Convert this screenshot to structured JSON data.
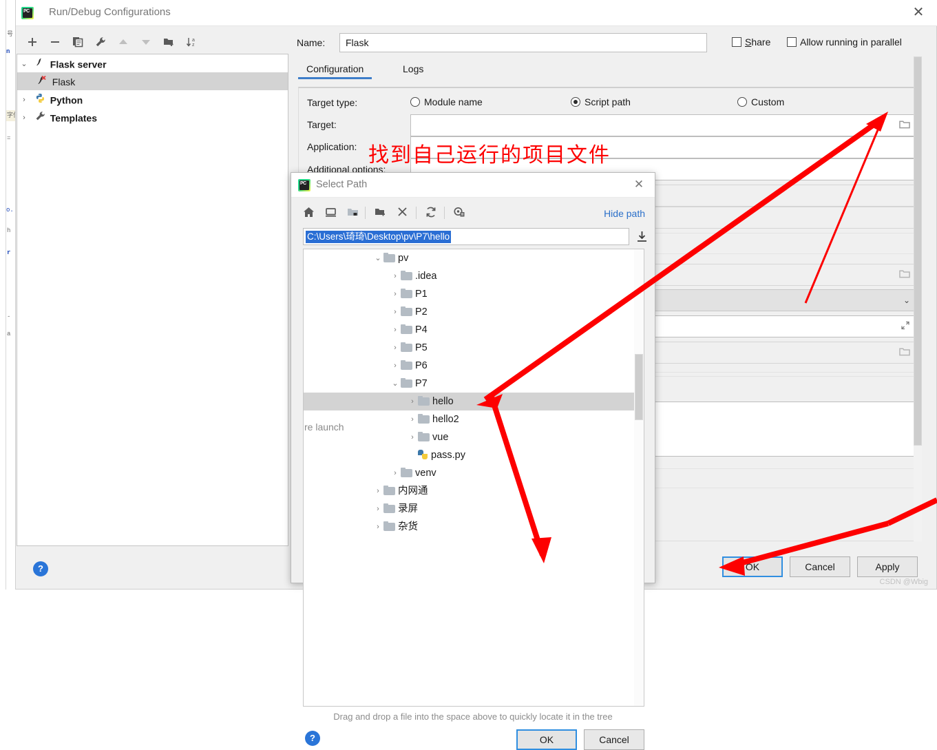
{
  "window": {
    "title": "Run/Debug Configurations",
    "close_label": "✕",
    "logo_text": "PC"
  },
  "left_toolbar": {
    "items": [
      {
        "name": "add-button",
        "icon": "plus-icon",
        "enabled": true
      },
      {
        "name": "remove-button",
        "icon": "minus-icon",
        "enabled": true
      },
      {
        "name": "copy-button",
        "icon": "copy-icon",
        "enabled": true
      },
      {
        "name": "edit-templates-button",
        "icon": "wrench-icon",
        "enabled": true
      },
      {
        "name": "move-up-button",
        "icon": "arrow-up-icon",
        "enabled": false
      },
      {
        "name": "move-down-button",
        "icon": "arrow-down-icon",
        "enabled": false
      },
      {
        "name": "new-folder-button",
        "icon": "folder-add-icon",
        "enabled": true
      },
      {
        "name": "sort-button",
        "icon": "sort-az-icon",
        "enabled": true
      }
    ]
  },
  "config_tree": {
    "items": [
      {
        "label": "Flask server",
        "expander": "⌄",
        "icon": "flask-icon",
        "indent": 0,
        "bold": true,
        "selected": false
      },
      {
        "label": "Flask",
        "expander": "",
        "icon": "flask-error-icon",
        "indent": 1,
        "bold": false,
        "selected": true
      },
      {
        "label": "Python",
        "expander": "›",
        "icon": "python-icon",
        "indent": 0,
        "bold": true,
        "selected": false
      },
      {
        "label": "Templates",
        "expander": "›",
        "icon": "wrench-icon",
        "indent": 0,
        "bold": true,
        "selected": false
      }
    ]
  },
  "help_button_label": "?",
  "form": {
    "name_label": "Name:",
    "name_value": "Flask",
    "share_label_pre": "",
    "share_label": "Share",
    "share_underline": "S",
    "parallel_label": "Allow running in parallel",
    "parallel_underline": "p",
    "tabs": [
      {
        "label": "Configuration",
        "active": true
      },
      {
        "label": "Logs",
        "active": false
      }
    ],
    "target_type_label": "Target type:",
    "target_type_options": [
      {
        "label": "Module name",
        "selected": false
      },
      {
        "label": "Script path",
        "selected": true
      },
      {
        "label": "Custom",
        "selected": false
      }
    ],
    "target_label": "Target:",
    "target_value": "",
    "application_label": "Application:",
    "application_value": "",
    "additional_options_label": "Additional options:",
    "additional_options_value": "",
    "before_launch_label": "re launch",
    "browse_icon": "folder-browse-icon",
    "dropdown_icon": "chevron-down-icon",
    "expand_icon": "expand-icon"
  },
  "annotation": {
    "text": "找到自己运行的项目文件",
    "color": "#fd0000"
  },
  "main_buttons": [
    {
      "label": "OK",
      "default": true,
      "name": "ok-button"
    },
    {
      "label": "Cancel",
      "default": false,
      "name": "cancel-button"
    },
    {
      "label": "Apply",
      "default": false,
      "name": "apply-button"
    }
  ],
  "select_path_dialog": {
    "title": "Select Path",
    "close_label": "✕",
    "toolbar": [
      {
        "name": "home-button",
        "icon": "home-icon"
      },
      {
        "name": "desktop-button",
        "icon": "desktop-icon"
      },
      {
        "name": "project-folder-button",
        "icon": "project-folder-icon"
      },
      {
        "name": "new-folder-button",
        "icon": "folder-add-icon"
      },
      {
        "name": "delete-button",
        "icon": "close-x-icon"
      },
      {
        "name": "refresh-button",
        "icon": "refresh-icon"
      },
      {
        "name": "show-hidden-button",
        "icon": "show-hidden-icon"
      }
    ],
    "hide_path_label": "Hide path",
    "path_value": "C:\\Users\\琦琦\\Desktop\\pv\\P7\\hello",
    "path_download_icon": "download-icon",
    "tree": [
      {
        "label": "pv",
        "expander": "⌄",
        "indent": 2,
        "icon": "folder-icon",
        "selected": false
      },
      {
        "label": ".idea",
        "expander": "›",
        "indent": 3,
        "icon": "folder-icon",
        "selected": false
      },
      {
        "label": "P1",
        "expander": "›",
        "indent": 3,
        "icon": "folder-icon",
        "selected": false
      },
      {
        "label": "P2",
        "expander": "›",
        "indent": 3,
        "icon": "folder-icon",
        "selected": false
      },
      {
        "label": "P4",
        "expander": "›",
        "indent": 3,
        "icon": "folder-icon",
        "selected": false
      },
      {
        "label": "P5",
        "expander": "›",
        "indent": 3,
        "icon": "folder-icon",
        "selected": false
      },
      {
        "label": "P6",
        "expander": "›",
        "indent": 3,
        "icon": "folder-icon",
        "selected": false
      },
      {
        "label": "P7",
        "expander": "⌄",
        "indent": 3,
        "icon": "folder-icon",
        "selected": false
      },
      {
        "label": "hello",
        "expander": "›",
        "indent": 4,
        "icon": "folder-icon",
        "selected": true
      },
      {
        "label": "hello2",
        "expander": "›",
        "indent": 4,
        "icon": "folder-icon",
        "selected": false
      },
      {
        "label": "vue",
        "expander": "›",
        "indent": 4,
        "icon": "folder-icon",
        "selected": false
      },
      {
        "label": "pass.py",
        "expander": "",
        "indent": 4,
        "icon": "python-file-icon",
        "selected": false
      },
      {
        "label": "venv",
        "expander": "›",
        "indent": 3,
        "icon": "folder-icon",
        "selected": false
      },
      {
        "label": "内网通",
        "expander": "›",
        "indent": 2,
        "icon": "folder-icon",
        "selected": false
      },
      {
        "label": "录屏",
        "expander": "›",
        "indent": 2,
        "icon": "folder-icon",
        "selected": false
      },
      {
        "label": "杂货",
        "expander": "›",
        "indent": 2,
        "icon": "folder-icon",
        "selected": false
      }
    ],
    "drag_note": "Drag and drop a file into the space above to quickly locate it in the tree",
    "help_button_label": "?",
    "buttons": [
      {
        "label": "OK",
        "default": true,
        "name": "dialog-ok-button"
      },
      {
        "label": "Cancel",
        "default": false,
        "name": "dialog-cancel-button"
      }
    ]
  },
  "watermark": "CSDN @Wbig"
}
